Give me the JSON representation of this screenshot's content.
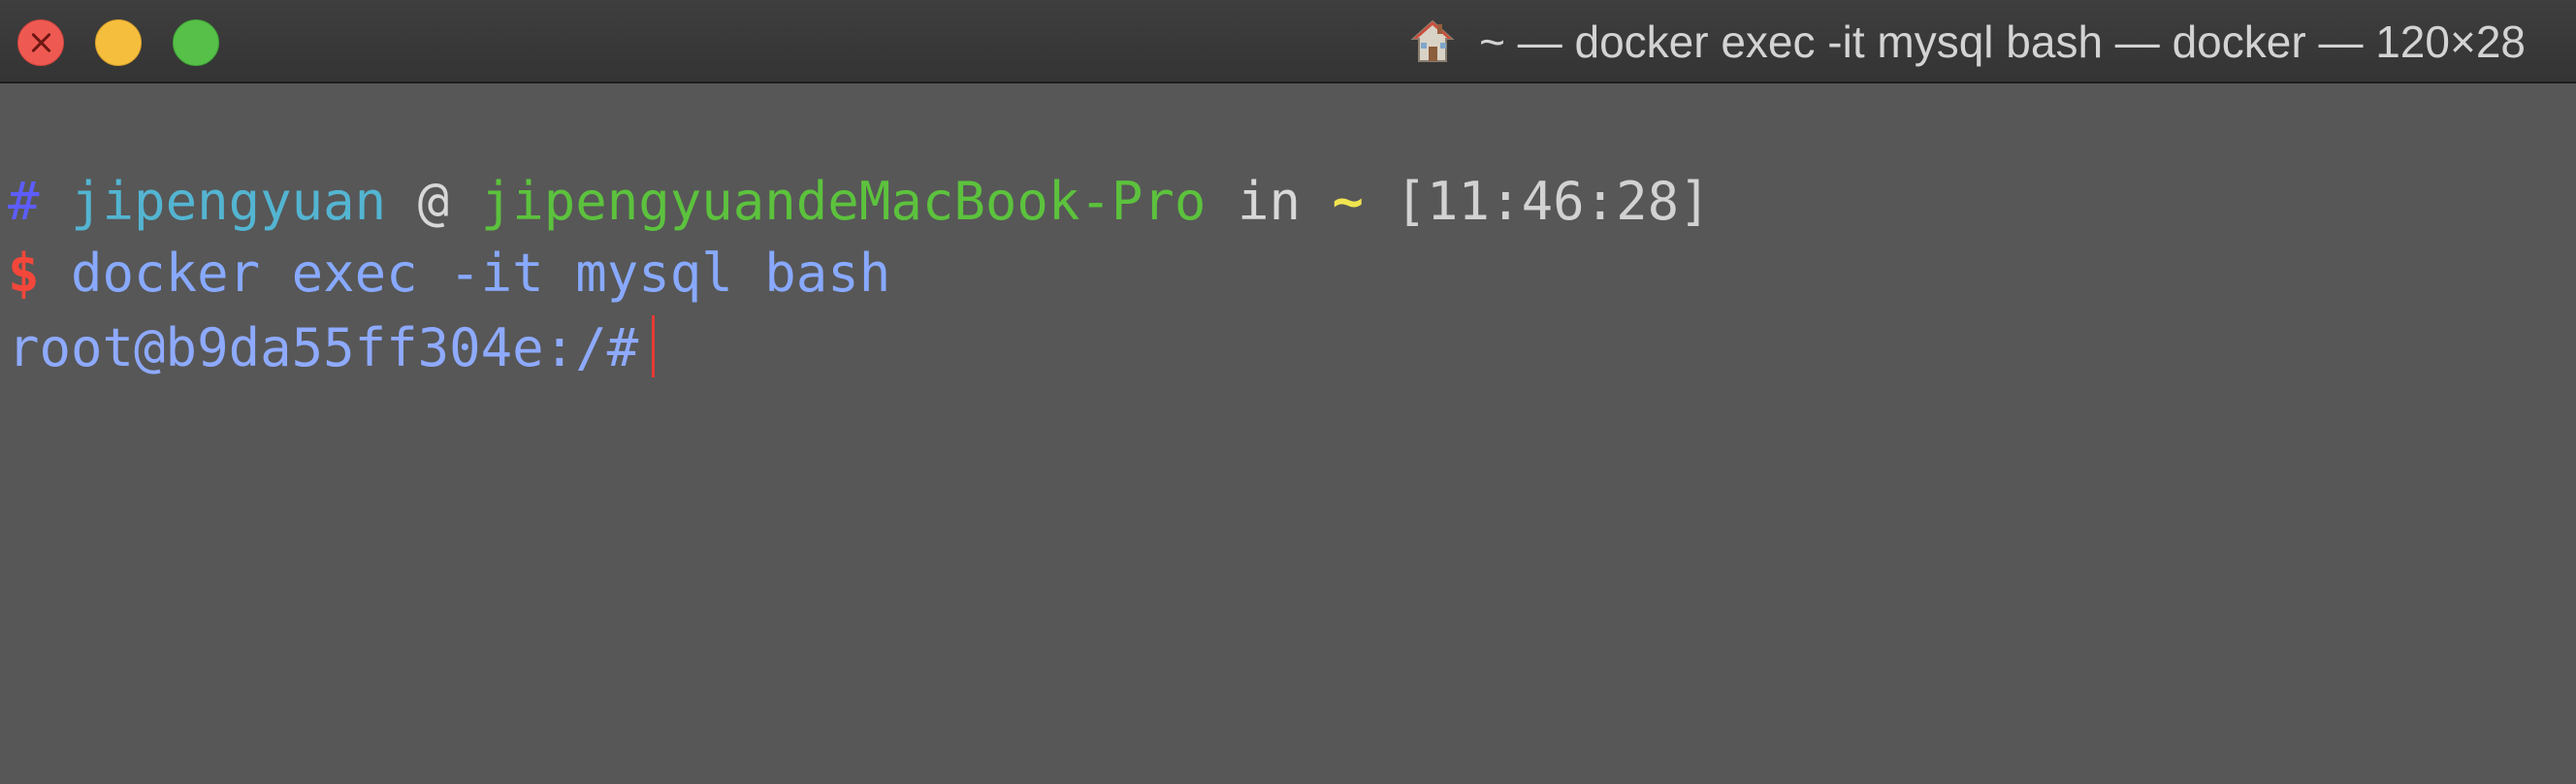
{
  "window": {
    "title": "~ — docker exec -it mysql bash — docker — 120×28",
    "home_icon": "house-icon",
    "controls": [
      "close",
      "minimize",
      "maximize"
    ],
    "colors": {
      "close": "#ee5a52",
      "minimize": "#f5be3d",
      "maximize": "#56c048",
      "background": "#575757"
    }
  },
  "terminal": {
    "prompt": {
      "hash": "#",
      "user": "jipengyuan",
      "at": "@",
      "host": "jipengyuandeMacBook-Pro",
      "in": "in",
      "dir": "~",
      "time": "[11:46:28]"
    },
    "command": {
      "symbol": "$",
      "text": "docker exec -it mysql bash"
    },
    "shell_prompt": "root@b9da55ff304e:/#"
  }
}
